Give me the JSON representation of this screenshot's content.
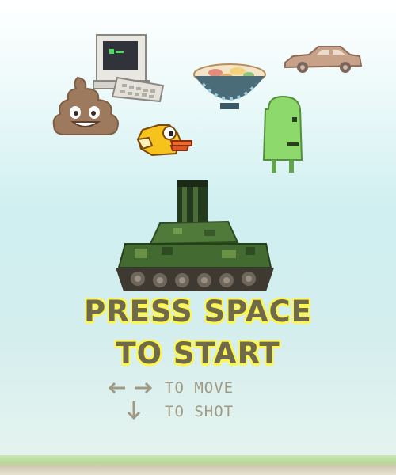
{
  "title": {
    "line1": "PRESS SPACE",
    "line2": "TO START"
  },
  "controls": [
    {
      "key_icon": "left-right-arrows-icon",
      "label": "TO MOVE"
    },
    {
      "key_icon": "down-arrow-icon",
      "label": "TO SHOT"
    }
  ],
  "sprites": [
    "computer-icon",
    "ramen-bowl-icon",
    "car-icon",
    "poop-emoji-icon",
    "flappy-bird-icon",
    "green-pickle-icon",
    "tank-icon"
  ],
  "colors": {
    "title_fill": "#6f6a4c",
    "title_outline": "#fff64a",
    "hint_text": "#a09a84"
  }
}
